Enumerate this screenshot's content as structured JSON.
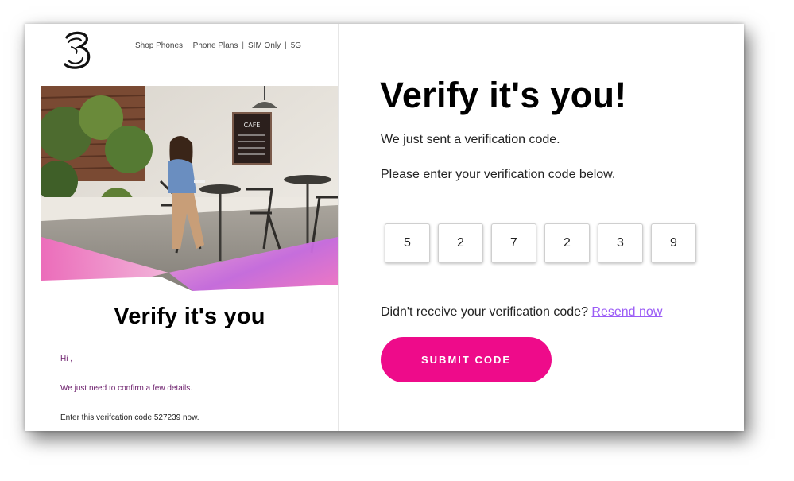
{
  "brand": {
    "logo_name": "three-logo",
    "accent": "#ee0b8a",
    "link_color": "#9b5cf6"
  },
  "email_preview": {
    "nav": [
      "Shop Phones",
      "Phone Plans",
      "SIM Only",
      "5G"
    ],
    "nav_separator": "|",
    "cafe_sign": "CAFE",
    "title": "Verify it's you",
    "greeting": "Hi ,",
    "line_confirm": "We just need to confirm a few details.",
    "line_code": "Enter this verifcation code 527239 now."
  },
  "verify": {
    "title": "Verify it's you!",
    "message_sent": "We just sent a verification code.",
    "message_enter": "Please enter your verification code below.",
    "code_digits": [
      "5",
      "2",
      "7",
      "2",
      "3",
      "9"
    ],
    "resend_prompt": "Didn't receive your verification code?",
    "resend_link": "Resend now",
    "submit_label": "SUBMIT CODE"
  }
}
